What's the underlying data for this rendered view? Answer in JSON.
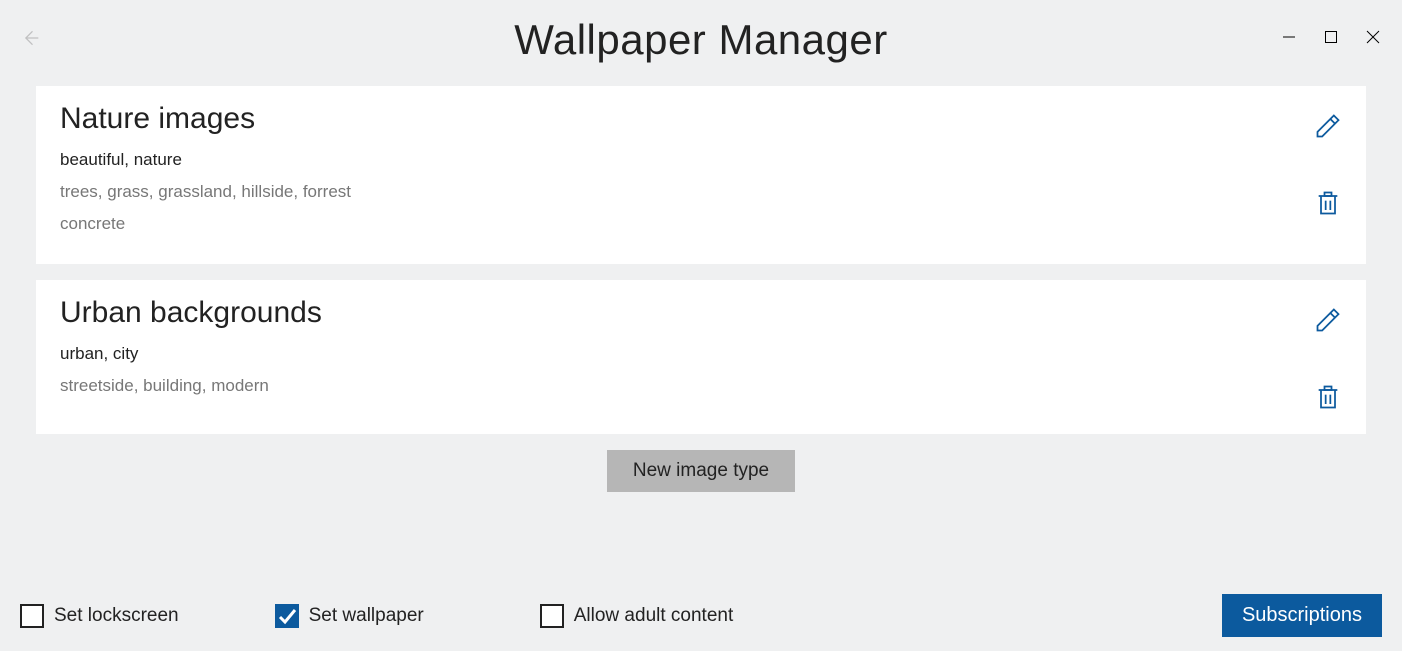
{
  "header": {
    "title": "Wallpaper Manager"
  },
  "cards": [
    {
      "title": "Nature images",
      "line1": "beautiful, nature",
      "line2": "trees, grass, grassland, hillside, forrest",
      "line3": "concrete"
    },
    {
      "title": "Urban backgrounds",
      "line1": "urban, city",
      "line2": "streetside, building, modern",
      "line3": ""
    }
  ],
  "buttons": {
    "new_image_type": "New image type",
    "subscriptions": "Subscriptions"
  },
  "checkboxes": {
    "lockscreen": {
      "label": "Set lockscreen",
      "checked": false
    },
    "wallpaper": {
      "label": "Set wallpaper",
      "checked": true
    },
    "adult": {
      "label": "Allow adult content",
      "checked": false
    }
  }
}
